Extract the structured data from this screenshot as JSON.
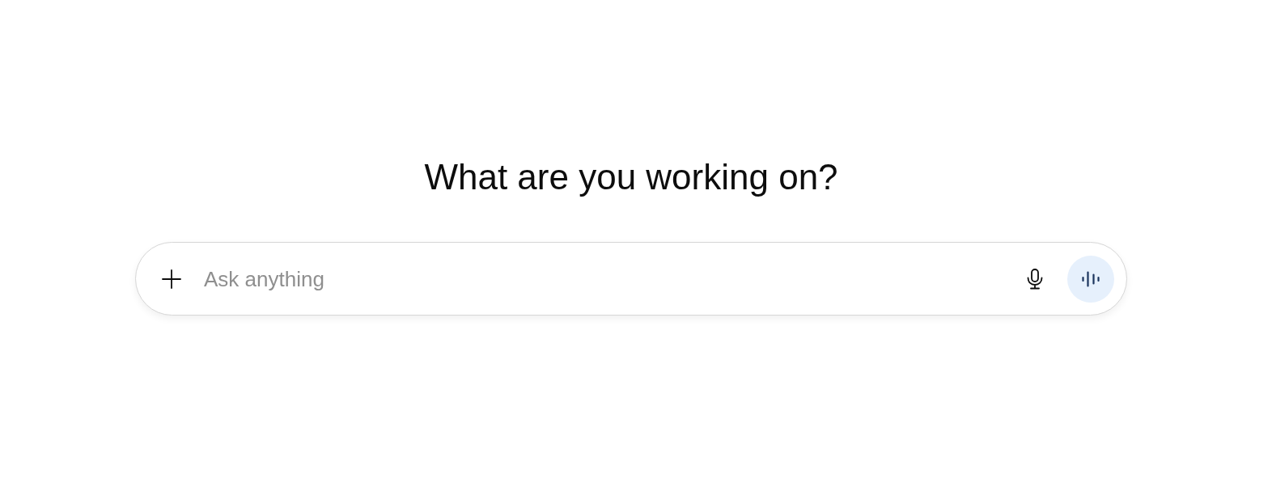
{
  "heading": "What are you working on?",
  "composer": {
    "placeholder": "Ask anything"
  }
}
